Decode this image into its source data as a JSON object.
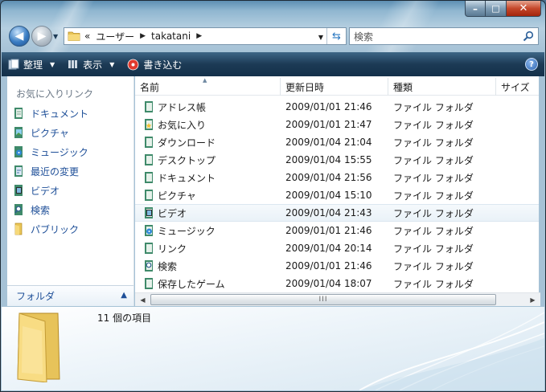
{
  "window": {
    "caption_min": "–",
    "caption_max": "□",
    "caption_close": "✕"
  },
  "nav": {
    "breadcrumb_overflow": "«",
    "breadcrumbs": [
      "ユーザー",
      "takatani"
    ],
    "search_placeholder": "検索"
  },
  "toolbar": {
    "organize_label": "整理",
    "view_label": "表示",
    "burn_label": "書き込む",
    "help_label": "?"
  },
  "sidebar": {
    "heading": "お気に入りリンク",
    "items": [
      {
        "label": "ドキュメント",
        "icon": "documents-icon"
      },
      {
        "label": "ピクチャ",
        "icon": "pictures-icon"
      },
      {
        "label": "ミュージック",
        "icon": "music-icon"
      },
      {
        "label": "最近の変更",
        "icon": "recent-changes-icon"
      },
      {
        "label": "ビデオ",
        "icon": "videos-icon"
      },
      {
        "label": "検索",
        "icon": "searches-icon"
      },
      {
        "label": "パブリック",
        "icon": "public-folder-icon"
      }
    ],
    "folders_label": "フォルダ",
    "folders_chevron": "^"
  },
  "list": {
    "columns": {
      "name": "名前",
      "modified": "更新日時",
      "type": "種類",
      "size": "サイズ"
    },
    "rows": [
      {
        "name": "アドレス帳",
        "modified": "2009/01/01 21:46",
        "type": "ファイル フォルダ",
        "icon": "contacts-folder-icon"
      },
      {
        "name": "お気に入り",
        "modified": "2009/01/01 21:47",
        "type": "ファイル フォルダ",
        "icon": "favorites-folder-icon"
      },
      {
        "name": "ダウンロード",
        "modified": "2009/01/04 21:04",
        "type": "ファイル フォルダ",
        "icon": "downloads-folder-icon"
      },
      {
        "name": "デスクトップ",
        "modified": "2009/01/04 15:55",
        "type": "ファイル フォルダ",
        "icon": "desktop-folder-icon"
      },
      {
        "name": "ドキュメント",
        "modified": "2009/01/04 21:56",
        "type": "ファイル フォルダ",
        "icon": "documents-folder-icon"
      },
      {
        "name": "ピクチャ",
        "modified": "2009/01/04 15:10",
        "type": "ファイル フォルダ",
        "icon": "pictures-folder-icon"
      },
      {
        "name": "ビデオ",
        "modified": "2009/01/04 21:43",
        "type": "ファイル フォルダ",
        "icon": "videos-folder-icon"
      },
      {
        "name": "ミュージック",
        "modified": "2009/01/01 21:46",
        "type": "ファイル フォルダ",
        "icon": "music-folder-icon"
      },
      {
        "name": "リンク",
        "modified": "2009/01/04 20:14",
        "type": "ファイル フォルダ",
        "icon": "links-folder-icon"
      },
      {
        "name": "検索",
        "modified": "2009/01/01 21:46",
        "type": "ファイル フォルダ",
        "icon": "searches-folder-icon"
      },
      {
        "name": "保存したゲーム",
        "modified": "2009/01/04 18:07",
        "type": "ファイル フォルダ",
        "icon": "saved-games-folder-icon"
      }
    ],
    "scroll_grip": "III"
  },
  "details": {
    "item_count": "11 個の項目"
  },
  "colors": {
    "link_blue": "#1e4f98",
    "toolbar_dark": "#1c3a55",
    "folder_green": "#3f8a6a"
  }
}
